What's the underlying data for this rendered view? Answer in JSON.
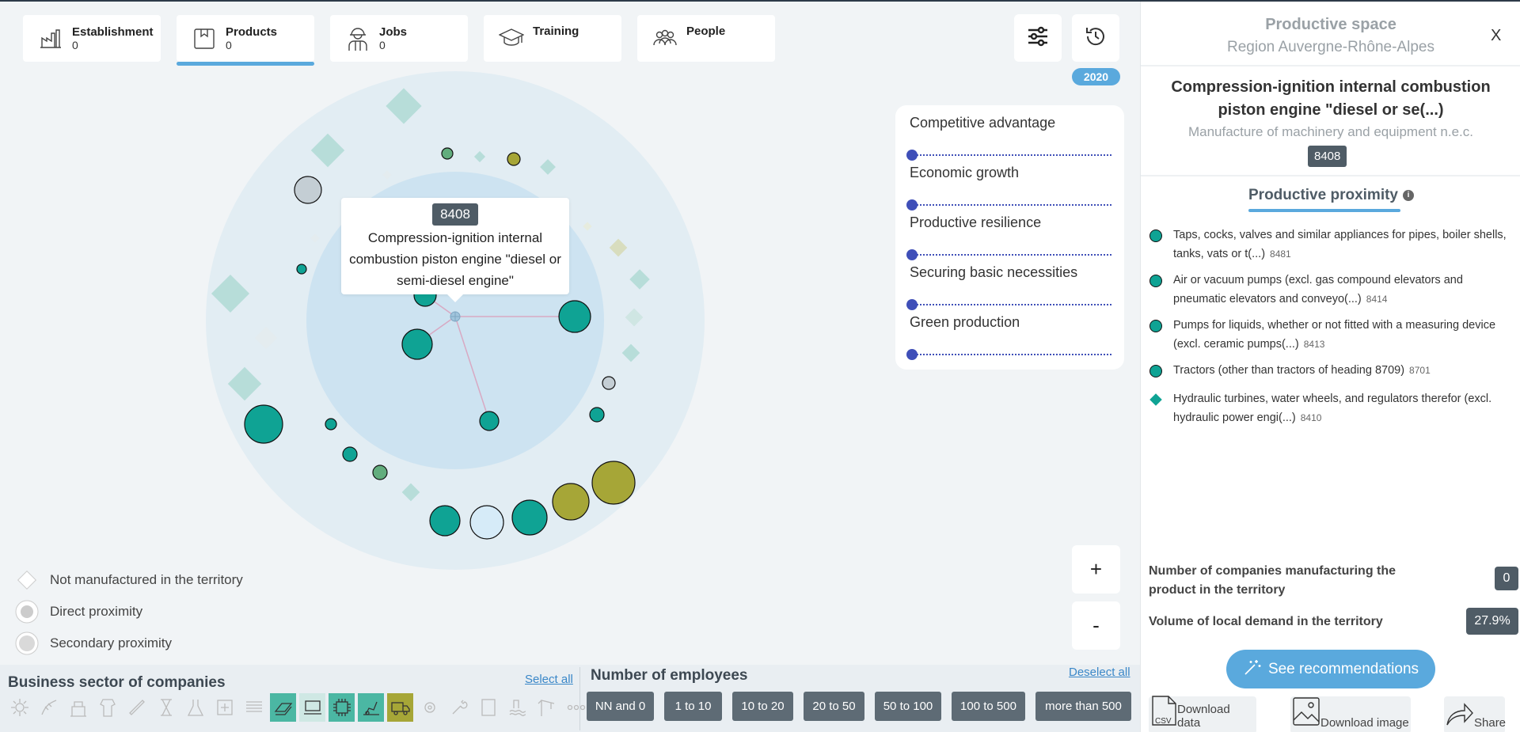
{
  "tabs": [
    {
      "label": "Establishment",
      "count": "0"
    },
    {
      "label": "Products",
      "count": "0"
    },
    {
      "label": "Jobs",
      "count": "0"
    },
    {
      "label": "Training",
      "count": ""
    },
    {
      "label": "People",
      "count": ""
    }
  ],
  "year": "2020",
  "tooltip": {
    "code": "8408",
    "text": "Compression-ignition internal combustion piston engine \"diesel or semi-diesel engine\""
  },
  "indicators": [
    "Competitive advantage",
    "Economic growth",
    "Productive resilience",
    "Securing basic necessities",
    "Green production"
  ],
  "legend": {
    "not_manufactured": "Not manufactured in the territory",
    "direct": "Direct proximity",
    "secondary": "Secondary proximity"
  },
  "zoom": {
    "plus": "+",
    "minus": "-"
  },
  "bottom": {
    "sector_title": "Business sector of companies",
    "select_all": "Select all",
    "employees_title": "Number of employees",
    "deselect_all": "Deselect all",
    "employee_buttons": [
      "NN and 0",
      "1 to 10",
      "10 to 20",
      "20 to 50",
      "50 to 100",
      "100 to 500",
      "more than 500"
    ]
  },
  "panel": {
    "title": "Productive space",
    "region": "Region Auvergne-Rhône-Alpes",
    "close": "X",
    "product_name": "Compression-ignition internal combustion piston engine \"diesel or se(...)",
    "sector": "Manufacture of machinery and equipment n.e.c.",
    "code": "8408",
    "proximity_title": "Productive proximity",
    "info": "i",
    "items": [
      {
        "text": "Taps, cocks, valves and similar appliances for pipes, boiler shells, tanks, vats or t(...)",
        "code": "8481",
        "marker": "circle"
      },
      {
        "text": "Air or vacuum pumps (excl. gas compound elevators and pneumatic elevators and conveyo(...)",
        "code": "8414",
        "marker": "circle"
      },
      {
        "text": "Pumps for liquids, whether or not fitted with a measuring device (excl. ceramic pumps(...)",
        "code": "8413",
        "marker": "circle"
      },
      {
        "text": "Tractors (other than tractors of heading 8709)",
        "code": "8701",
        "marker": "circle"
      },
      {
        "text": "Hydraulic turbines, water wheels, and regulators therefor (excl. hydraulic power engi(...)",
        "code": "8410",
        "marker": "diamond"
      }
    ],
    "stat_companies_label": "Number of companies manufacturing the product in the territory",
    "stat_companies_value": "0",
    "stat_demand_label": "Volume of local demand in the territory",
    "stat_demand_value": "27.9%",
    "recommendations": "See recommendations",
    "download_data": "Download data",
    "download_image": "Download image",
    "share": "Share",
    "csv": "CSV"
  },
  "colors": {
    "accent": "#5aa9dd",
    "teal": "#0fa394",
    "olive": "#a6a637",
    "badge": "#4f5c66",
    "slider": "#3f4fb8"
  }
}
